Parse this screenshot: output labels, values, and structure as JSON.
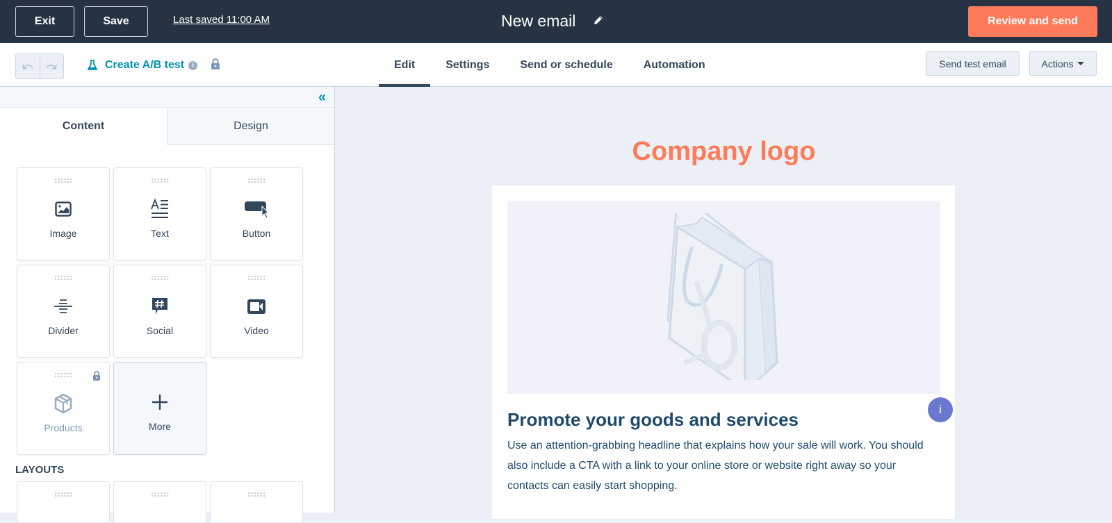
{
  "topbar": {
    "exit_label": "Exit",
    "save_label": "Save",
    "last_saved": "Last saved 11:00 AM",
    "email_title": "New email",
    "review_label": "Review and send"
  },
  "subbar": {
    "ab_test_label": "Create A/B test",
    "tabs": [
      {
        "label": "Edit",
        "active": true
      },
      {
        "label": "Settings",
        "active": false
      },
      {
        "label": "Send or schedule",
        "active": false
      },
      {
        "label": "Automation",
        "active": false
      }
    ],
    "send_test_label": "Send test email",
    "actions_label": "Actions"
  },
  "sidebar": {
    "tabs": [
      {
        "label": "Content",
        "active": true
      },
      {
        "label": "Design",
        "active": false
      }
    ],
    "modules": [
      {
        "label": "Image",
        "icon": "image-icon"
      },
      {
        "label": "Text",
        "icon": "text-icon"
      },
      {
        "label": "Button",
        "icon": "button-icon"
      },
      {
        "label": "Divider",
        "icon": "divider-icon"
      },
      {
        "label": "Social",
        "icon": "social-icon"
      },
      {
        "label": "Video",
        "icon": "video-icon"
      },
      {
        "label": "Products",
        "icon": "products-icon",
        "locked": true
      },
      {
        "label": "More",
        "icon": "plus-icon"
      }
    ],
    "layouts_title": "LAYOUTS"
  },
  "canvas": {
    "logo_text": "Company logo",
    "promo_title": "Promote your goods and services",
    "promo_text": "Use an attention-grabbing headline that explains how your sale will work. You should also include a CTA with a link to your online store or website right away so your contacts can easily start shopping.",
    "info_bubble": "i"
  },
  "colors": {
    "topbar": "#253342",
    "accent_orange": "#ff7a59",
    "link_teal": "#0091ae",
    "text_dark": "#33475b",
    "info_purple": "#6a78d1"
  }
}
